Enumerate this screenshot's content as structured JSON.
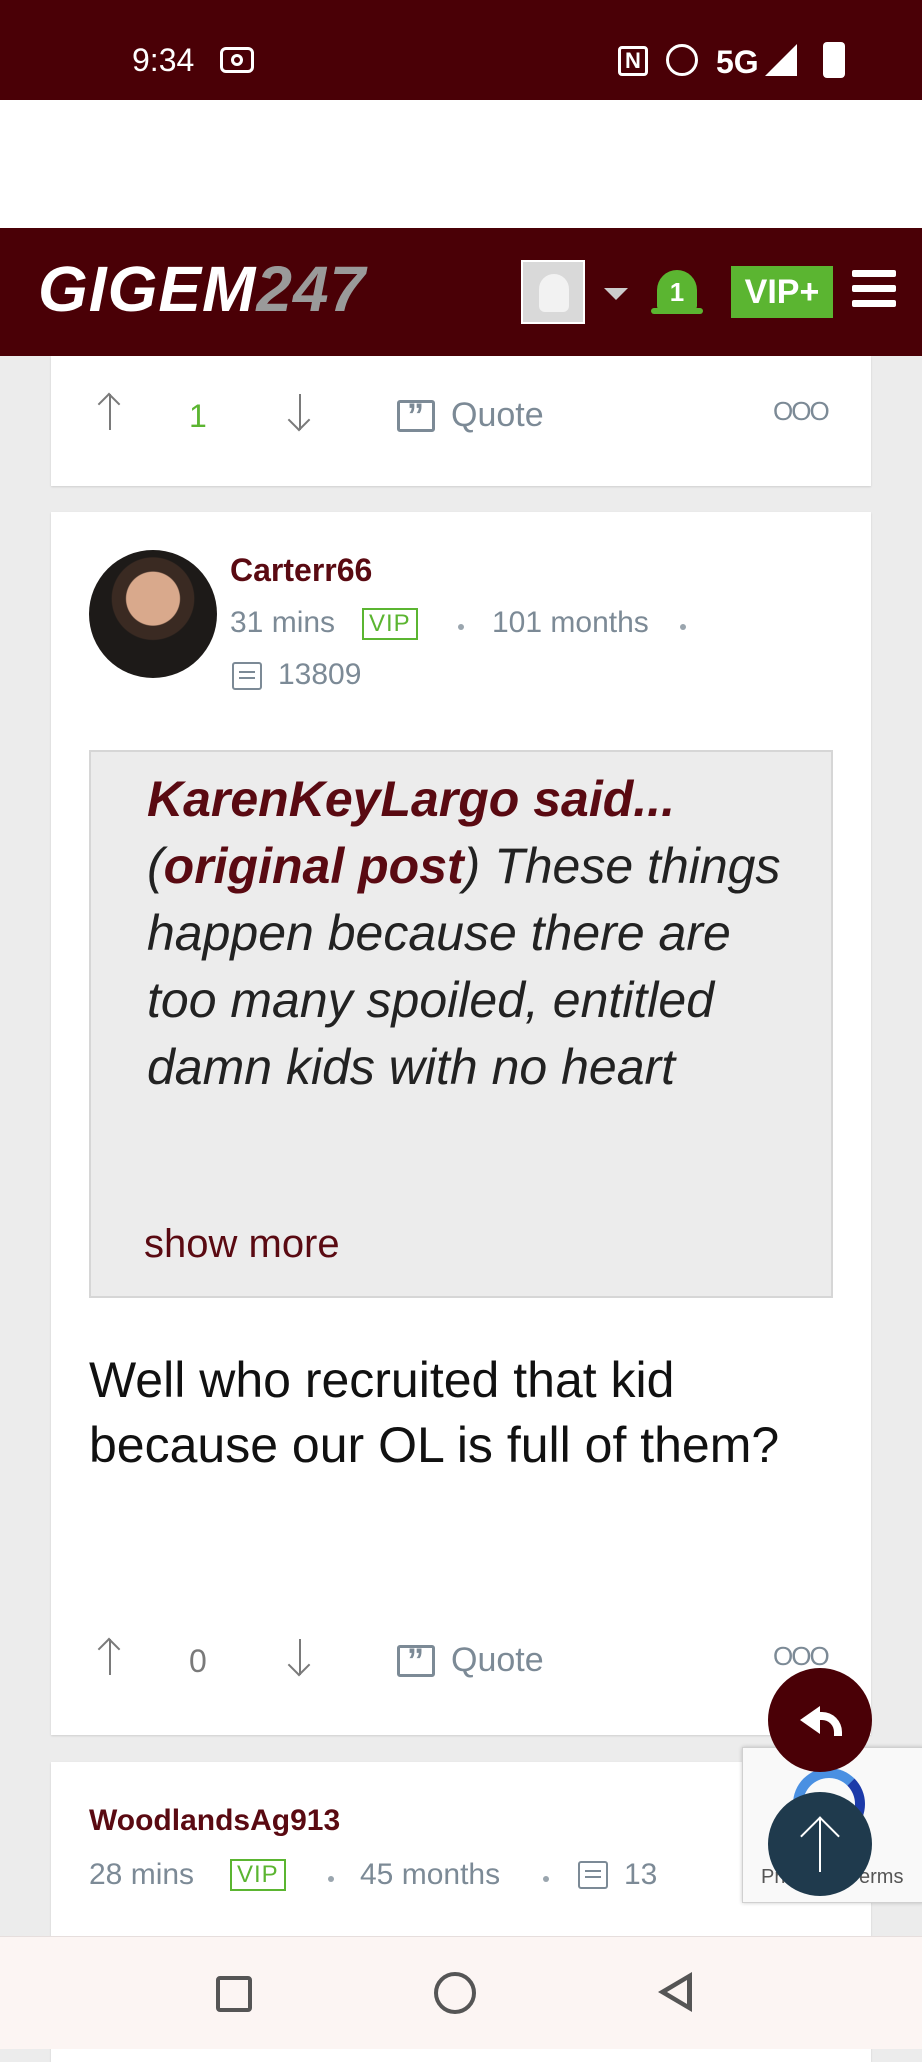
{
  "status_bar": {
    "time": "9:34",
    "network": "5G",
    "nfc_label": "N"
  },
  "header": {
    "logo_text": "GIGEM",
    "logo_number": "247",
    "notification_count": "1",
    "vip_label": "VIP+"
  },
  "previous_post": {
    "score": "1",
    "quote_label": "Quote",
    "more_label": "OOO"
  },
  "main_post": {
    "username": "Carterr66",
    "time": "31 mins",
    "badge": "VIP",
    "tenure": "101 months",
    "post_count": "13809",
    "quoted_author": "KarenKeyLargo said...",
    "quoted_link": "original post",
    "quoted_text": "These things happen because there are too many spoiled, entitled damn kids with no heart",
    "show_more": "show more",
    "body": "Well who recruited that kid because our OL is full of them?",
    "score": "0",
    "quote_label": "Quote",
    "more_label": "OOO"
  },
  "next_post": {
    "username": "WoodlandsAg913",
    "time": "28 mins",
    "badge": "VIP",
    "tenure": "45 months",
    "post_count": "13"
  },
  "recaptcha": {
    "text_left": "Pri",
    "text_right": "erms"
  },
  "colors": {
    "brand_maroon": "#4a0006",
    "vip_green": "#5bb531",
    "username": "#5a0a12",
    "meta_gray": "#7c8a96",
    "top_button": "#1f3a4d"
  }
}
